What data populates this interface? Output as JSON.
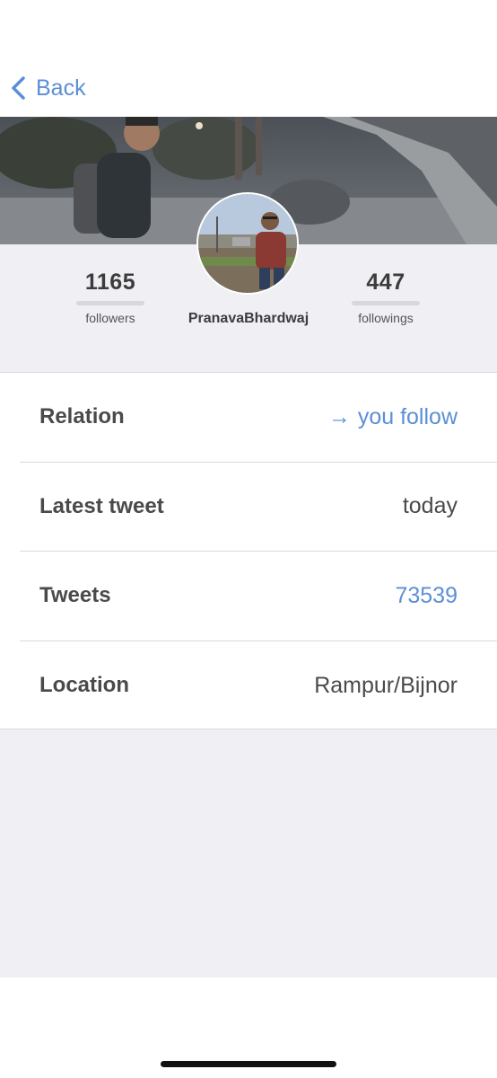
{
  "nav": {
    "back_label": "Back"
  },
  "profile": {
    "username": "PranavaBhardwaj",
    "followers_count": "1165",
    "followers_label": "followers",
    "followings_count": "447",
    "followings_label": "followings"
  },
  "details": [
    {
      "label": "Relation",
      "value": "you follow",
      "icon": "arrow-right-icon",
      "link": true
    },
    {
      "label": "Latest tweet",
      "value": "today",
      "link": false
    },
    {
      "label": "Tweets",
      "value": "73539",
      "link": true
    },
    {
      "label": "Location",
      "value": "Rampur/Bijnor",
      "link": false
    }
  ],
  "colors": {
    "accent": "#5b8fd6",
    "background_gray": "#efeff4",
    "text": "#4a4a4a"
  }
}
